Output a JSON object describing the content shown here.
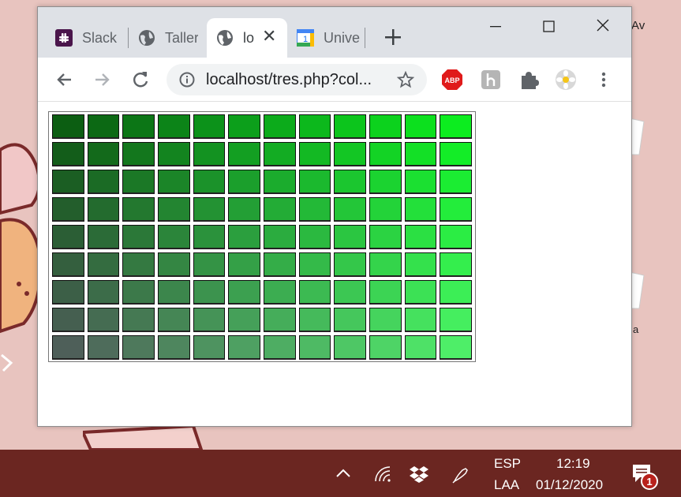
{
  "desktop": {
    "label_av": "Av",
    "label_a": "a"
  },
  "browser": {
    "tabs": [
      {
        "label": "Slack",
        "icon": "slack-icon"
      },
      {
        "label": "Taller",
        "icon": "globe-icon"
      },
      {
        "label": "lo",
        "icon": "globe-icon",
        "active": true
      },
      {
        "label": "Unive",
        "icon": "calendar-icon",
        "icon_text": "1"
      }
    ],
    "url": "localhost/tres.php?col...",
    "extensions": {
      "abp_text": "ABP"
    }
  },
  "page": {
    "grid_rows": [
      [
        "#0c5e12",
        "#0c6914",
        "#0c7616",
        "#0c8418",
        "#0c921a",
        "#0c9f1b",
        "#0cab1b",
        "#0cb81c",
        "#0cc51c",
        "#0cd21d",
        "#0ce01e",
        "#0ced1f"
      ],
      [
        "#135d1a",
        "#136a1b",
        "#13771d",
        "#13841f",
        "#139221",
        "#139f22",
        "#13ac23",
        "#13b923",
        "#13c624",
        "#13d325",
        "#13e026",
        "#13ed27"
      ],
      [
        "#1b5e23",
        "#1b6b25",
        "#1b7826",
        "#1b8528",
        "#1b922a",
        "#1b9f2c",
        "#1bac2d",
        "#1bb92e",
        "#1bc62f",
        "#1bd330",
        "#1be031",
        "#1bed32"
      ],
      [
        "#235e2c",
        "#236b2e",
        "#23782f",
        "#238531",
        "#239233",
        "#239f35",
        "#23ac36",
        "#23b937",
        "#23c638",
        "#23d339",
        "#23e03a",
        "#23ed3b"
      ],
      [
        "#2b5e35",
        "#2b6b37",
        "#2b7838",
        "#2b853a",
        "#2b923c",
        "#2b9f3e",
        "#2bac3f",
        "#2bb940",
        "#2bc641",
        "#2bd342",
        "#2be043",
        "#2bed44"
      ],
      [
        "#345f3e",
        "#346c40",
        "#347941",
        "#348643",
        "#349345",
        "#34a047",
        "#34ad48",
        "#34ba49",
        "#34c74a",
        "#34d44b",
        "#34e14c",
        "#34ee4d"
      ],
      [
        "#3c5f47",
        "#3c6c49",
        "#3c794a",
        "#3c864c",
        "#3c934e",
        "#3ca050",
        "#3cad51",
        "#3cba52",
        "#3cc753",
        "#3cd454",
        "#3ce155",
        "#3cee56"
      ],
      [
        "#455f50",
        "#456c52",
        "#457953",
        "#458655",
        "#459357",
        "#45a059",
        "#45ad5a",
        "#45ba5b",
        "#45c75c",
        "#45d45d",
        "#45e15e",
        "#45ee5f"
      ],
      [
        "#4e5f59",
        "#4e6c5b",
        "#4e795c",
        "#4e865e",
        "#4e9360",
        "#4ea062",
        "#4ead63",
        "#4eba64",
        "#4ec765",
        "#4ed466",
        "#4ee167",
        "#4eee68"
      ]
    ]
  },
  "taskbar": {
    "lang_top": "ESP",
    "lang_bottom": "LAA",
    "time": "12:19",
    "date": "01/12/2020",
    "notification_count": "1"
  }
}
